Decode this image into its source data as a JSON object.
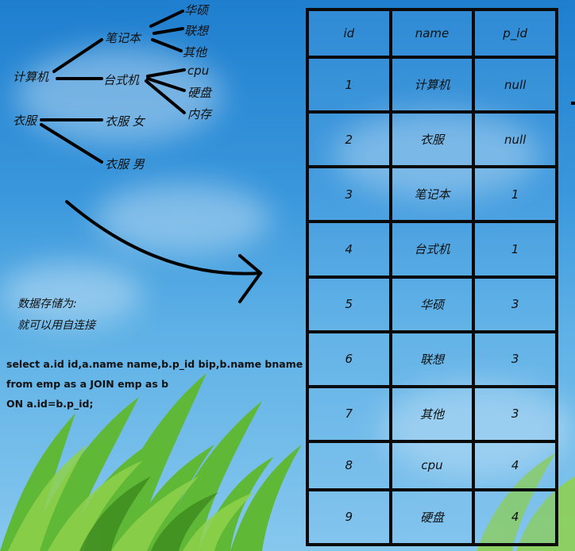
{
  "tree": {
    "root_computer": "计算机",
    "notebook": "笔记本",
    "desktop": "台式机",
    "brand_asus": "华硕",
    "brand_lenovo": "联想",
    "brand_other": "其他",
    "part_cpu": "cpu",
    "part_disk": "硬盘",
    "part_memory": "内存",
    "root_clothes": "衣服",
    "clothes_female": "衣服 女",
    "clothes_male": "衣服 男"
  },
  "notes": {
    "line1": "数据存储为:",
    "line2": "就可以用自连接"
  },
  "sql": {
    "line1": "select a.id id,a.name name,b.p_id bip,b.name bname",
    "line2": "from emp as a JOIN emp as b",
    "line3": "ON a.id=b.p_id;"
  },
  "table": {
    "headers": [
      "id",
      "name",
      "p_id"
    ],
    "rows": [
      [
        "1",
        "计算机",
        "null"
      ],
      [
        "2",
        "衣服",
        "null"
      ],
      [
        "3",
        "笔记本",
        "1"
      ],
      [
        "4",
        "台式机",
        "1"
      ],
      [
        "5",
        "华硕",
        "3"
      ],
      [
        "6",
        "联想",
        "3"
      ],
      [
        "7",
        "其他",
        "3"
      ],
      [
        "8",
        "cpu",
        "4"
      ],
      [
        "9",
        "硬盘",
        "4"
      ]
    ]
  }
}
